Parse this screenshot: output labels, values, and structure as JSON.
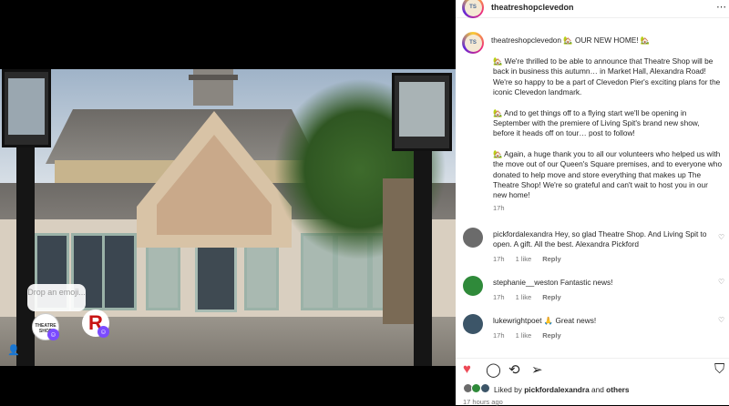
{
  "media": {
    "sticker_prompt": "Drop an emoji...",
    "sticker_a_text": "THEATRE SHOP",
    "sticker_r_text": "R",
    "badge_icon": "face-icon"
  },
  "header": {
    "username": "theatreshopclevedon",
    "more_icon": "more-icon"
  },
  "caption": {
    "username": "theatreshopclevedon",
    "headline": "🏡 OUR NEW HOME! 🏡",
    "paragraphs": [
      "🏡 We're thrilled to be able to announce that Theatre Shop will be back in business this autumn… in Market Hall, Alexandra Road! We're so happy to be a part of Clevedon Pier's exciting plans for the iconic Clevedon landmark.",
      "🏡 And to get things off to a flying start we'll be opening in September with the premiere of Living Spit's brand new show, before it heads off on tour… post to follow!",
      "🏡 Again, a huge thank you to all our volunteers who helped us with the move out of our Queen's Square premises, and to everyone who donated to help move and store everything that makes up The Theatre Shop! We're so grateful and can't wait to host you in our new home!"
    ],
    "time": "17h"
  },
  "comments": [
    {
      "username": "pickfordalexandra",
      "text": "Hey, so glad Theatre Shop. And Living Spit to open. A gift. All the best. Alexandra Pickford",
      "time": "17h",
      "likes": "1 like",
      "reply": "Reply",
      "avatar_color": "#6b6b6b"
    },
    {
      "username": "stephanie__weston",
      "text": "Fantastic news!",
      "time": "17h",
      "likes": "1 like",
      "reply": "Reply",
      "avatar_color": "#2f8a3a"
    },
    {
      "username": "lukewrightpoet",
      "text": "🙏 Great news!",
      "time": "17h",
      "likes": "1 like",
      "reply": "Reply",
      "avatar_color": "#3c5568"
    }
  ],
  "actions": {
    "like_icon": "heart-icon",
    "comment_icon": "comment-icon",
    "share_icon": "repost-icon",
    "send_icon": "send-icon",
    "save_icon": "bookmark-icon",
    "like_color": "#ed4956"
  },
  "likes": {
    "prefix": "Liked by ",
    "first_user": "pickfordalexandra",
    "and": " and ",
    "others": "others"
  },
  "posted": "17 hours ago"
}
